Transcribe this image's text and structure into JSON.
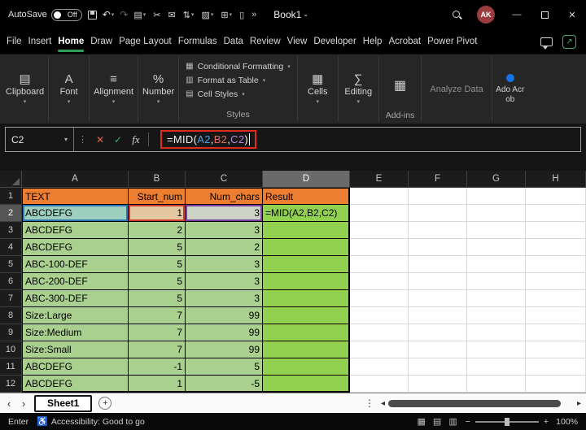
{
  "colors": {
    "header_fill": "#ED7D31",
    "data_fill": "#A9D08E",
    "result_fill": "#92D050",
    "ref_blue": "#2E75B6",
    "ref_red": "#CF3A32",
    "ref_purple": "#7B3FA0",
    "accent_green": "#2E9E5B",
    "annotation_red": "#E02A1D"
  },
  "titlebar": {
    "autosave_label": "AutoSave",
    "autosave_state": "Off",
    "doc_title": "Book1  -",
    "avatar_initials": "AK",
    "quick_icons": [
      {
        "name": "paste-icon",
        "glyph": "▤",
        "chevron": true
      },
      {
        "name": "cut-icon",
        "glyph": "✂",
        "chevron": false
      },
      {
        "name": "mail-icon",
        "glyph": "✉",
        "chevron": false
      },
      {
        "name": "sort-icon",
        "glyph": "⇅",
        "chevron": true
      },
      {
        "name": "fill-color-icon",
        "glyph": "▨",
        "chevron": true
      },
      {
        "name": "borders-icon",
        "glyph": "⊞",
        "chevron": true
      },
      {
        "name": "device-icon",
        "glyph": "▯",
        "chevron": false
      }
    ]
  },
  "icons": {
    "undo": "↶",
    "redo": "↷",
    "overflow": "»",
    "chevron": "▾",
    "handle": "⋮",
    "cancel": "✕",
    "check": "✓",
    "fx": "fx",
    "share": "↗",
    "nav_left": "‹",
    "nav_right": "›",
    "scroll_left": "◂",
    "scroll_right": "▸",
    "accessibility": "♿",
    "view_normal": "▦",
    "view_layout": "▤",
    "view_break": "▥",
    "zoom_out": "−",
    "zoom_in": "+",
    "add": "+",
    "minimize": "—",
    "close": "✕"
  },
  "menubar": {
    "items": [
      "File",
      "Insert",
      "Home",
      "Draw",
      "Page Layout",
      "Formulas",
      "Data",
      "Review",
      "View",
      "Developer",
      "Help",
      "Acrobat",
      "Power Pivot"
    ],
    "active_item": "Home"
  },
  "ribbon": {
    "groups": [
      {
        "type": "collapsed",
        "label": "Clipboard",
        "icon": "▤",
        "icon_name": "clipboard-icon"
      },
      {
        "type": "collapsed",
        "label": "Font",
        "icon": "A",
        "icon_name": "font-icon"
      },
      {
        "type": "collapsed",
        "label": "Alignment",
        "icon": "≡",
        "icon_name": "alignment-icon"
      },
      {
        "type": "collapsed",
        "label": "Number",
        "icon": "%",
        "icon_name": "number-icon"
      },
      {
        "type": "styles",
        "label": "Styles",
        "items": [
          {
            "label": "Conditional Formatting",
            "icon": "▦",
            "icon_name": "conditional-formatting-icon"
          },
          {
            "label": "Format as Table",
            "icon": "▥",
            "icon_name": "format-as-table-icon"
          },
          {
            "label": "Cell Styles",
            "icon": "▤",
            "icon_name": "cell-styles-icon"
          }
        ]
      },
      {
        "type": "collapsed",
        "label": "Cells",
        "icon": "▦",
        "icon_name": "cells-icon"
      },
      {
        "type": "collapsed",
        "label": "Editing",
        "icon": "∑",
        "icon_name": "editing-icon"
      },
      {
        "type": "addins",
        "label": "Add-ins",
        "icon": "▦",
        "icon_name": "add-ins-icon"
      },
      {
        "type": "button",
        "label": "Analyze Data"
      },
      {
        "type": "acrobat",
        "label": "Ado Acrob"
      }
    ]
  },
  "formula_bar": {
    "name_box_value": "C2",
    "formula": [
      {
        "t": "=MID(",
        "c": "plain"
      },
      {
        "t": "A2",
        "c": "blue"
      },
      {
        "t": ",",
        "c": "plain"
      },
      {
        "t": "B2",
        "c": "red"
      },
      {
        "t": ",",
        "c": "plain"
      },
      {
        "t": "C2",
        "c": "purple"
      },
      {
        "t": ")",
        "c": "plain"
      }
    ]
  },
  "grid": {
    "column_headers": [
      "A",
      "B",
      "C",
      "D",
      "E",
      "F",
      "G",
      "H"
    ],
    "active_column": "D",
    "active_row": 2,
    "rows": [
      {
        "n": 1,
        "type": "header",
        "cells": [
          "TEXT",
          "Start_num",
          "Num_chars",
          "Result"
        ]
      },
      {
        "n": 2,
        "cells": [
          "ABCDEFG",
          "1",
          "3",
          "=MID(A2,B2,C2)"
        ]
      },
      {
        "n": 3,
        "cells": [
          "ABCDEFG",
          "2",
          "3",
          ""
        ]
      },
      {
        "n": 4,
        "cells": [
          "ABCDEFG",
          "5",
          "2",
          ""
        ]
      },
      {
        "n": 5,
        "cells": [
          "ABC-100-DEF",
          "5",
          "3",
          ""
        ]
      },
      {
        "n": 6,
        "cells": [
          "ABC-200-DEF",
          "5",
          "3",
          ""
        ]
      },
      {
        "n": 7,
        "cells": [
          "ABC-300-DEF",
          "5",
          "3",
          ""
        ]
      },
      {
        "n": 8,
        "cells": [
          "Size:Large",
          "7",
          "99",
          ""
        ]
      },
      {
        "n": 9,
        "cells": [
          "Size:Medium",
          "7",
          "99",
          ""
        ]
      },
      {
        "n": 10,
        "cells": [
          "Size:Small",
          "7",
          "99",
          ""
        ]
      },
      {
        "n": 11,
        "cells": [
          "ABCDEFG",
          "-1",
          "5",
          ""
        ]
      },
      {
        "n": 12,
        "cells": [
          "ABCDEFG",
          "1",
          "-5",
          ""
        ]
      }
    ]
  },
  "sheet_bar": {
    "tabs": [
      {
        "name": "Sheet1",
        "active": true
      }
    ]
  },
  "status_bar": {
    "mode": "Enter",
    "accessibility_text": "Accessibility: Good to go",
    "zoom_level": "100%"
  }
}
